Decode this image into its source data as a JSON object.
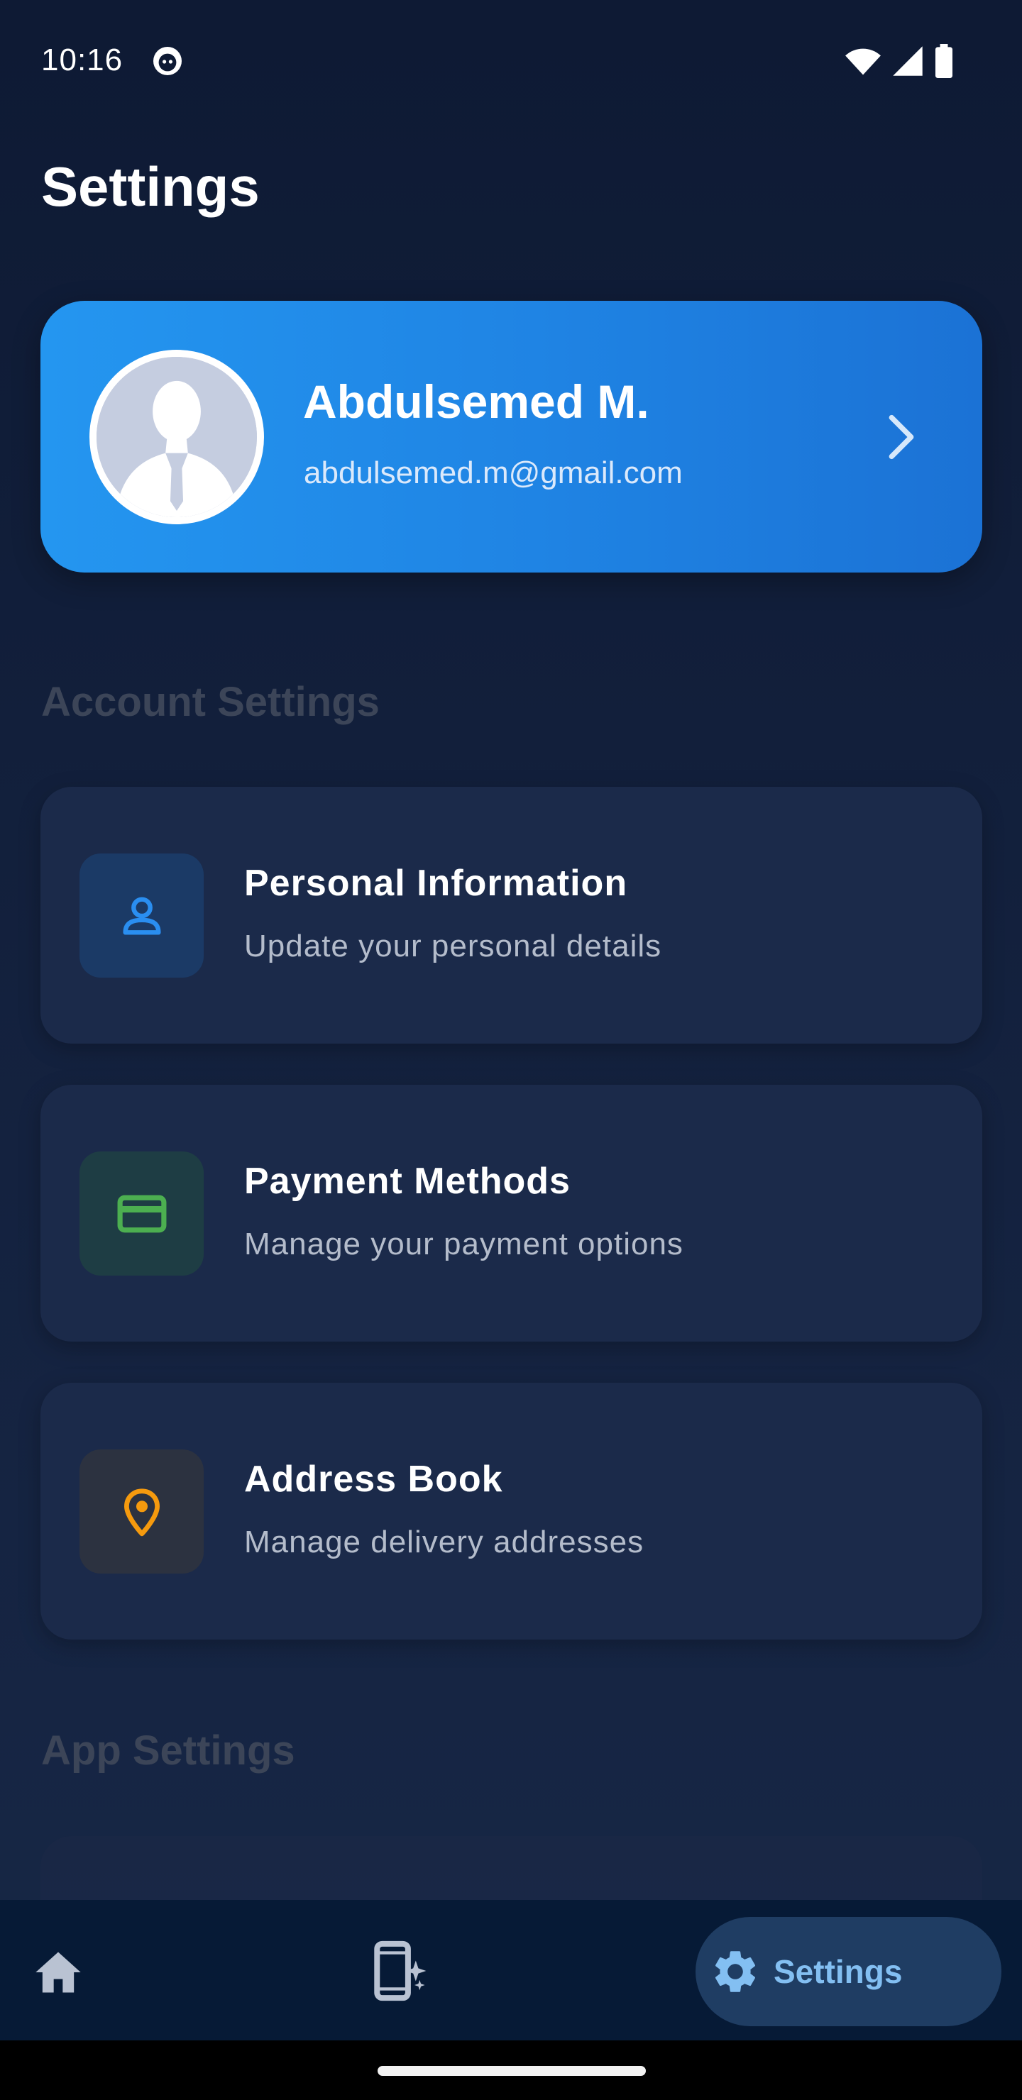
{
  "status_bar": {
    "time": "10:16",
    "icons": [
      "cat-notification-icon",
      "wifi-icon",
      "signal-icon",
      "battery-icon"
    ]
  },
  "page": {
    "title": "Settings"
  },
  "profile": {
    "name": "Abdulsemed M.",
    "email": "abdulsemed.m@gmail.com",
    "gradient": [
      "#2496f0",
      "#1b72d5"
    ]
  },
  "sections": {
    "account": "Account Settings",
    "app": "App Settings"
  },
  "account_items": [
    {
      "title": "Personal Information",
      "subtitle": "Update your personal details",
      "icon": "person-icon",
      "color": "#2a8ef0"
    },
    {
      "title": "Payment Methods",
      "subtitle": "Manage your payment options",
      "icon": "credit-card-icon",
      "color": "#4caf50"
    },
    {
      "title": "Address Book",
      "subtitle": "Manage delivery addresses",
      "icon": "location-pin-icon",
      "color": "#f59a0e"
    }
  ],
  "bottom_nav": {
    "items": [
      {
        "icon": "home-icon",
        "label": ""
      },
      {
        "icon": "device-sparkle-icon",
        "label": ""
      },
      {
        "icon": "gear-icon",
        "label": "Settings",
        "active": true
      }
    ],
    "active_color": "#83bff2"
  }
}
